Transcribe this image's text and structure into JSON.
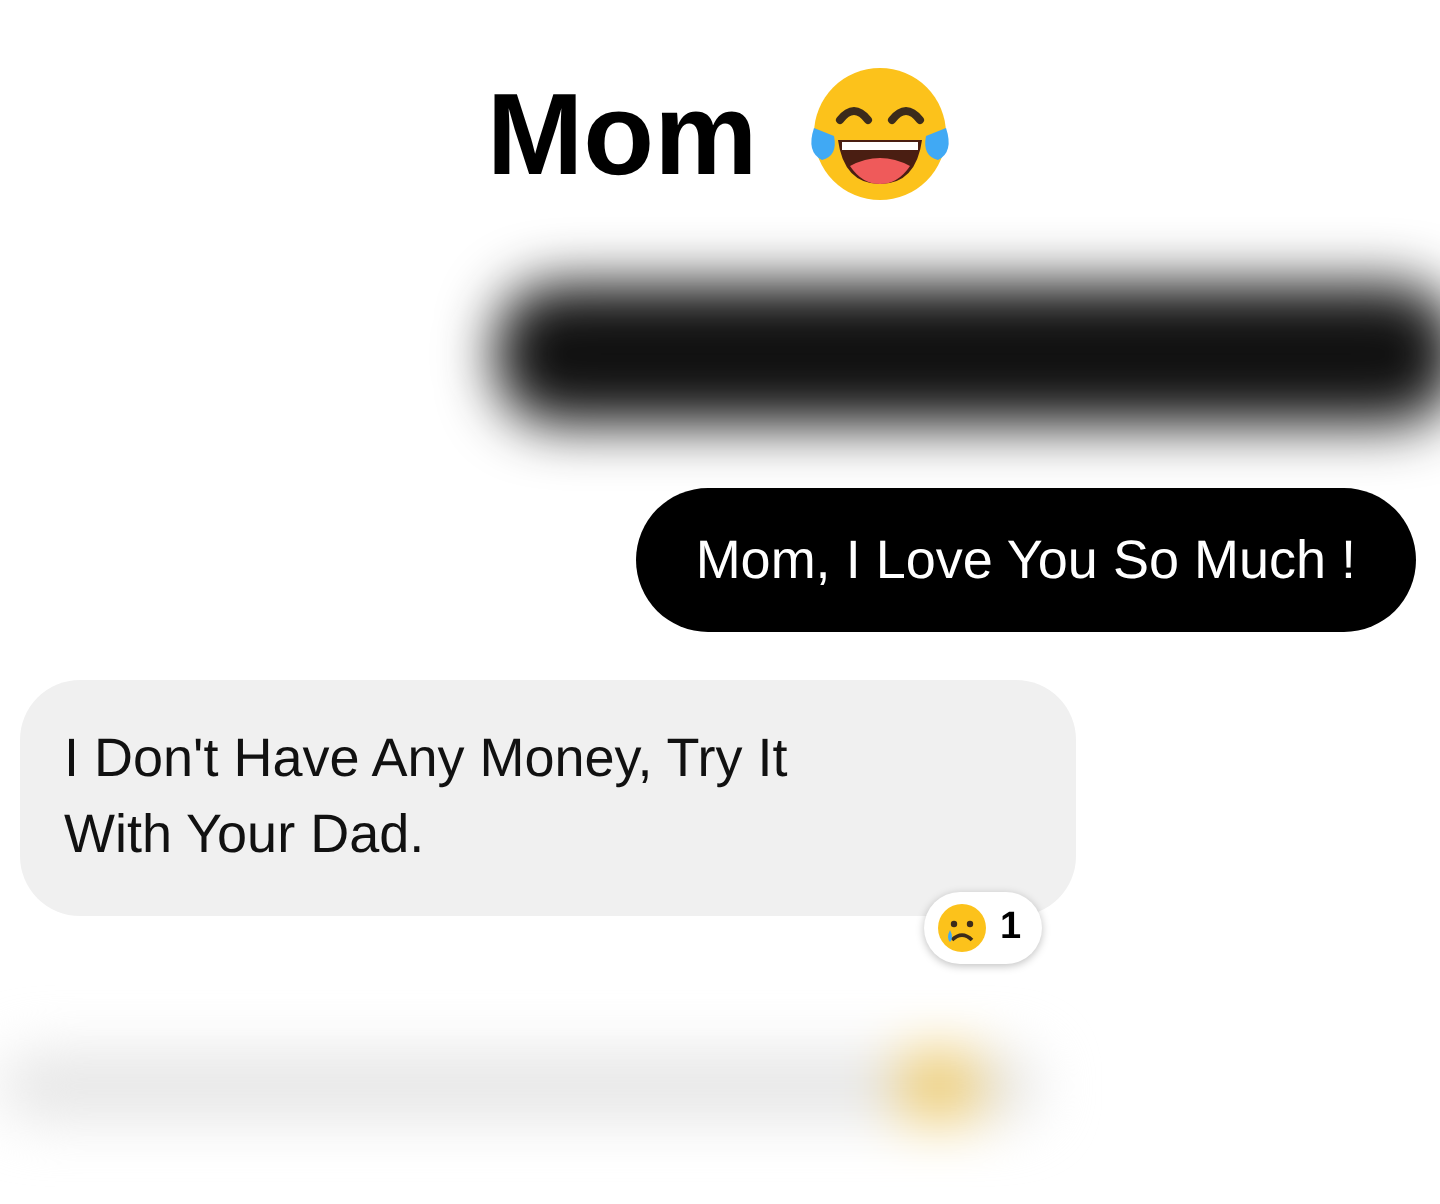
{
  "header": {
    "title": "Mom"
  },
  "messages": [
    {
      "kind": "blurred",
      "sent": true
    },
    {
      "kind": "text",
      "sent": true,
      "text": "Mom, I Love You So Much !"
    },
    {
      "kind": "text",
      "sent": false,
      "text": "I Don't Have Any Money, Try It With Your Dad.",
      "reaction": {
        "count": "1"
      }
    },
    {
      "kind": "blurred",
      "sent": false
    }
  ]
}
